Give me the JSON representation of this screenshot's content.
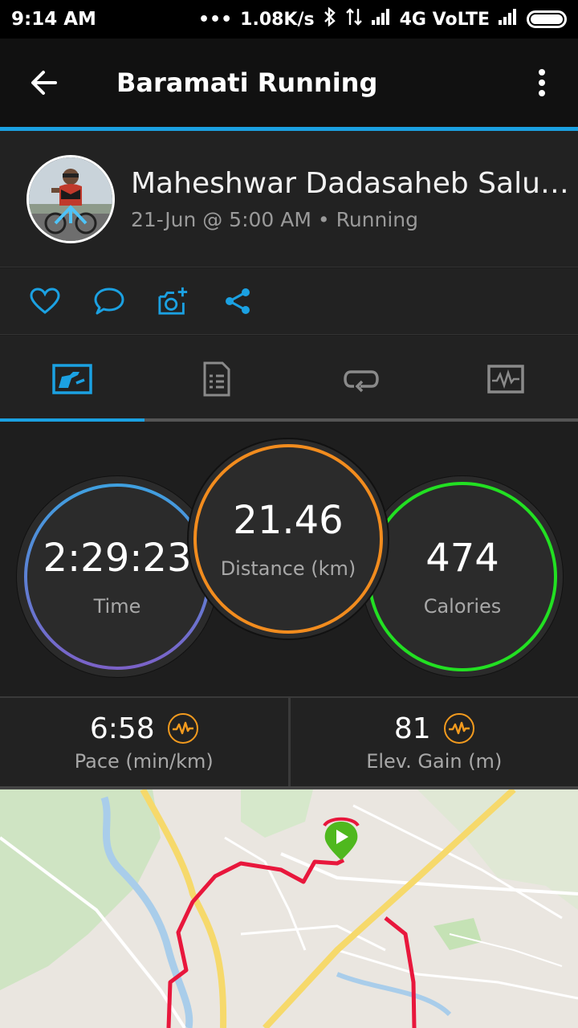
{
  "status_bar": {
    "time": "9:14 AM",
    "dots": "•••",
    "speed": "1.08K/s",
    "network": "4G VoLTE"
  },
  "app_bar": {
    "title": "Baramati Running",
    "back_icon": "arrow-left-icon",
    "more_icon": "more-vert-icon"
  },
  "profile": {
    "name": "Maheshwar Dadasaheb Salun…",
    "subtitle": "21-Jun @ 5:00 AM • Running"
  },
  "actions": [
    "heart-icon",
    "comment-icon",
    "add-photo-icon",
    "share-icon"
  ],
  "tabs": [
    "stats-tab-icon",
    "details-tab-icon",
    "laps-tab-icon",
    "charts-tab-icon"
  ],
  "stats": {
    "time": {
      "value": "2:29:23",
      "label": "Time"
    },
    "distance": {
      "value": "21.46",
      "label": "Distance (km)"
    },
    "calories": {
      "value": "474",
      "label": "Calories"
    }
  },
  "metrics": {
    "pace": {
      "value": "6:58",
      "label": "Pace (min/km)"
    },
    "elevation": {
      "value": "81",
      "label": "Elev. Gain (m)"
    }
  },
  "colors": {
    "accent": "#1ba1e2",
    "distance_ring": "#f28c1e",
    "calories_ring": "#22e022",
    "time_ring_top": "#3fa0e0",
    "time_ring_bottom": "#7b62c8",
    "route": "#e8173c",
    "start_marker": "#4fb81e"
  }
}
